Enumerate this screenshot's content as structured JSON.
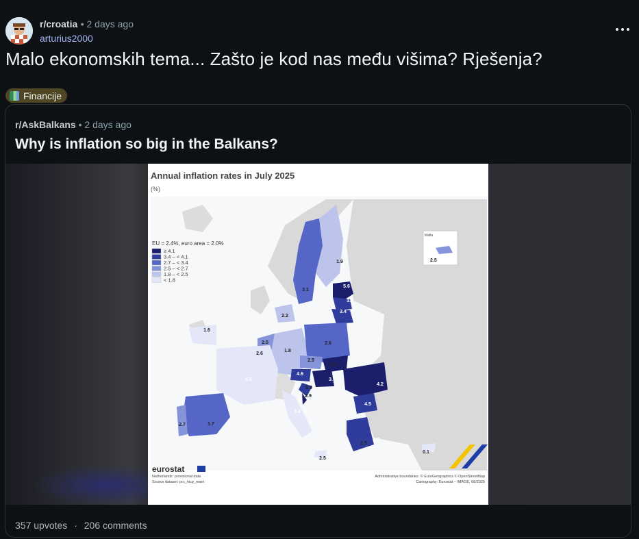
{
  "post": {
    "subreddit": "r/croatia",
    "age": "2 days ago",
    "author": "arturius2000",
    "title": "Malo ekonomskih tema... Zašto je kod nas među višima? Rješenja?",
    "flair": "Financije"
  },
  "crosspost": {
    "subreddit": "r/AskBalkans",
    "age": "2 days ago",
    "title": "Why is inflation so big in the Balkans?"
  },
  "map": {
    "title": "Annual inflation rates in July 2025",
    "unit": "(%)",
    "summary": "EU = 2.4%, euro area = 2.0%",
    "legend": [
      {
        "label": "≥ 4.1",
        "color": "#1b1f6b"
      },
      {
        "label": "3.4 – < 4.1",
        "color": "#2f3c9c"
      },
      {
        "label": "2.7 – < 3.4",
        "color": "#5566c6"
      },
      {
        "label": "2.5 – < 2.7",
        "color": "#8593d9"
      },
      {
        "label": "1.8 – < 2.5",
        "color": "#bcc4ec"
      },
      {
        "label": "< 1.8",
        "color": "#e3e7f7"
      }
    ],
    "values": [
      {
        "label": "1.9",
        "color": "#bcc4ec"
      },
      {
        "label": "3.1",
        "color": "#5566c6"
      },
      {
        "label": "5.6",
        "color": "#1b1f6b"
      },
      {
        "label": "3.9",
        "color": "#2f3c9c"
      },
      {
        "label": "3.4",
        "color": "#2f3c9c"
      },
      {
        "label": "2.2",
        "color": "#bcc4ec"
      },
      {
        "label": "1.6",
        "color": "#e3e7f7"
      },
      {
        "label": "2.5",
        "color": "#8593d9"
      },
      {
        "label": "2.6",
        "color": "#8593d9"
      },
      {
        "label": "1.8",
        "color": "#bcc4ec"
      },
      {
        "label": "2.6",
        "color": "#8593d9"
      },
      {
        "label": "2.9",
        "color": "#5566c6"
      },
      {
        "label": "2.5",
        "color": "#8593d9"
      },
      {
        "label": "4.6",
        "color": "#1b1f6b"
      },
      {
        "label": "3.7",
        "color": "#2f3c9c"
      },
      {
        "label": "4.2",
        "color": "#1b1f6b"
      },
      {
        "label": "6.6",
        "color": "#1b1f6b"
      },
      {
        "label": "0.9",
        "color": "#e3e7f7"
      },
      {
        "label": "2.9",
        "color": "#5566c6"
      },
      {
        "label": "4.5",
        "color": "#1b1f6b"
      },
      {
        "label": "3.4",
        "color": "#2f3c9c"
      },
      {
        "label": "1.7",
        "color": "#e3e7f7"
      },
      {
        "label": "2.7",
        "color": "#5566c6"
      },
      {
        "label": "2.5",
        "color": "#8593d9"
      },
      {
        "label": "3.7",
        "color": "#2f3c9c"
      },
      {
        "label": "2.5",
        "color": "#8593d9"
      },
      {
        "label": "0.1",
        "color": "#e3e7f7"
      }
    ],
    "malta_label": "Malta",
    "malta_value": "2.5",
    "brand": "eurostat",
    "note1": "Netherlands: provisional data",
    "note2": "Source dataset: prc_hicp_manr",
    "credit1": "Administrative boundaries: © EuroGeographics © OpenStreetMap",
    "credit2": "Cartography: Eurostat – IMAGE, 08/2025"
  },
  "stats": {
    "upvotes": "357 upvotes",
    "separator": "·",
    "comments": "206 comments"
  }
}
